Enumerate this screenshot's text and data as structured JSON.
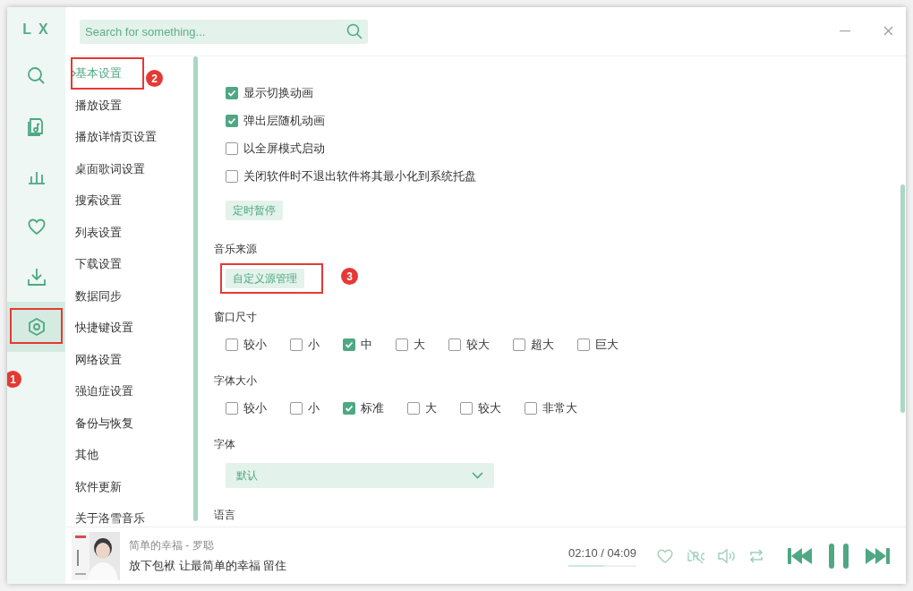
{
  "brand": "L X",
  "search": {
    "placeholder": "Search for something..."
  },
  "rail": [
    {
      "kind": "search",
      "selected": false
    },
    {
      "kind": "music",
      "selected": false
    },
    {
      "kind": "chart",
      "selected": false
    },
    {
      "kind": "heart",
      "selected": false
    },
    {
      "kind": "download",
      "selected": false
    },
    {
      "kind": "settings",
      "selected": true,
      "callout": "1"
    }
  ],
  "nav": [
    {
      "label": "基本设置",
      "selected": true,
      "callout": "2"
    },
    {
      "label": "播放设置",
      "selected": false
    },
    {
      "label": "播放详情页设置",
      "selected": false
    },
    {
      "label": "桌面歌词设置",
      "selected": false
    },
    {
      "label": "搜索设置",
      "selected": false
    },
    {
      "label": "列表设置",
      "selected": false
    },
    {
      "label": "下载设置",
      "selected": false
    },
    {
      "label": "数据同步",
      "selected": false
    },
    {
      "label": "快捷键设置",
      "selected": false
    },
    {
      "label": "网络设置",
      "selected": false
    },
    {
      "label": "强迫症设置",
      "selected": false
    },
    {
      "label": "备份与恢复",
      "selected": false
    },
    {
      "label": "其他",
      "selected": false
    },
    {
      "label": "软件更新",
      "selected": false
    },
    {
      "label": "关于洛雪音乐",
      "selected": false
    }
  ],
  "settings": [
    {
      "kind": "checkbox",
      "label": "显示切换动画",
      "checked": true
    },
    {
      "kind": "checkbox",
      "label": "弹出层随机动画",
      "checked": true
    },
    {
      "kind": "checkbox",
      "label": "以全屏模式启动",
      "checked": false
    },
    {
      "kind": "checkbox",
      "label": "关闭软件时不退出软件将其最小化到系统托盘",
      "checked": false
    },
    {
      "kind": "button",
      "label": "定时暂停"
    },
    {
      "kind": "heading",
      "label": "音乐来源"
    },
    {
      "kind": "button",
      "label": "自定义源管理",
      "callout": "3"
    },
    {
      "kind": "heading",
      "label": "窗口尺寸"
    },
    {
      "kind": "options",
      "options": [
        {
          "label": "较小",
          "checked": false
        },
        {
          "label": "小",
          "checked": false
        },
        {
          "label": "中",
          "checked": true
        },
        {
          "label": "大",
          "checked": false
        },
        {
          "label": "较大",
          "checked": false
        },
        {
          "label": "超大",
          "checked": false
        },
        {
          "label": "巨大",
          "checked": false
        }
      ]
    },
    {
      "kind": "heading",
      "label": "字体大小"
    },
    {
      "kind": "options",
      "options": [
        {
          "label": "较小",
          "checked": false
        },
        {
          "label": "小",
          "checked": false
        },
        {
          "label": "标准",
          "checked": true
        },
        {
          "label": "大",
          "checked": false
        },
        {
          "label": "较大",
          "checked": false
        },
        {
          "label": "非常大",
          "checked": false
        }
      ]
    },
    {
      "kind": "heading",
      "label": "字体"
    },
    {
      "kind": "select",
      "value": "默认"
    },
    {
      "kind": "heading",
      "label": "语言"
    }
  ],
  "player": {
    "title": "简单的幸福 - 罗聪",
    "lyric": "放下包袱 让最简单的幸福 留住",
    "time": "02:10 / 04:09",
    "level": 0.52
  }
}
